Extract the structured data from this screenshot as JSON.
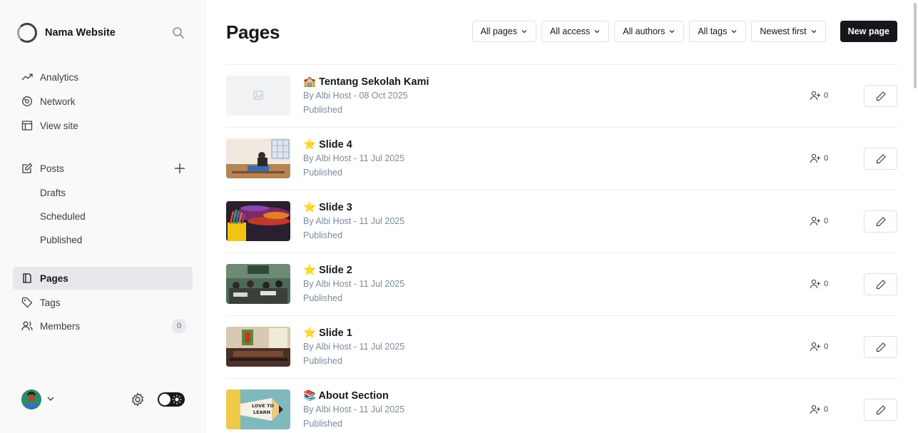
{
  "sidebar": {
    "site_name": "Nama Website",
    "nav_top": [
      {
        "label": "Analytics",
        "icon": "analytics-icon"
      },
      {
        "label": "Network",
        "icon": "network-icon"
      },
      {
        "label": "View site",
        "icon": "view-site-icon"
      }
    ],
    "posts": {
      "label": "Posts",
      "sub": [
        "Drafts",
        "Scheduled",
        "Published"
      ]
    },
    "nav_bottom": [
      {
        "label": "Pages",
        "icon": "pages-icon",
        "active": true
      },
      {
        "label": "Tags",
        "icon": "tag-icon"
      },
      {
        "label": "Members",
        "icon": "members-icon",
        "count": "0"
      }
    ]
  },
  "header": {
    "title": "Pages",
    "filters": [
      "All pages",
      "All access",
      "All authors",
      "All tags",
      "Newest first"
    ],
    "new_button": "New page"
  },
  "pages": [
    {
      "title": "🏫 Tentang Sekolah Kami",
      "meta": "By Albi Host - 08 Oct 2025",
      "status": "Published",
      "members": "0",
      "thumb": "placeholder"
    },
    {
      "title": "⭐ Slide 4",
      "meta": "By Albi Host - 11 Jul 2025",
      "status": "Published",
      "members": "0",
      "thumb": "classroom-desk"
    },
    {
      "title": "⭐ Slide 3",
      "meta": "By Albi Host - 11 Jul 2025",
      "status": "Published",
      "members": "0",
      "thumb": "crayons"
    },
    {
      "title": "⭐ Slide 2",
      "meta": "By Albi Host - 11 Jul 2025",
      "status": "Published",
      "members": "0",
      "thumb": "students-class"
    },
    {
      "title": "⭐ Slide 1",
      "meta": "By Albi Host - 11 Jul 2025",
      "status": "Published",
      "members": "0",
      "thumb": "library-room"
    },
    {
      "title": "📚 About Section",
      "meta": "By Albi Host - 11 Jul 2025",
      "status": "Published",
      "members": "0",
      "thumb": "love-to-learn-pencil",
      "thumb_text": [
        "LOVE TO",
        "LEARN"
      ]
    }
  ],
  "colors": {
    "accent": "#15171a",
    "sidebar_bg": "#f9f9fa",
    "muted_text": "#7c8b9a"
  }
}
